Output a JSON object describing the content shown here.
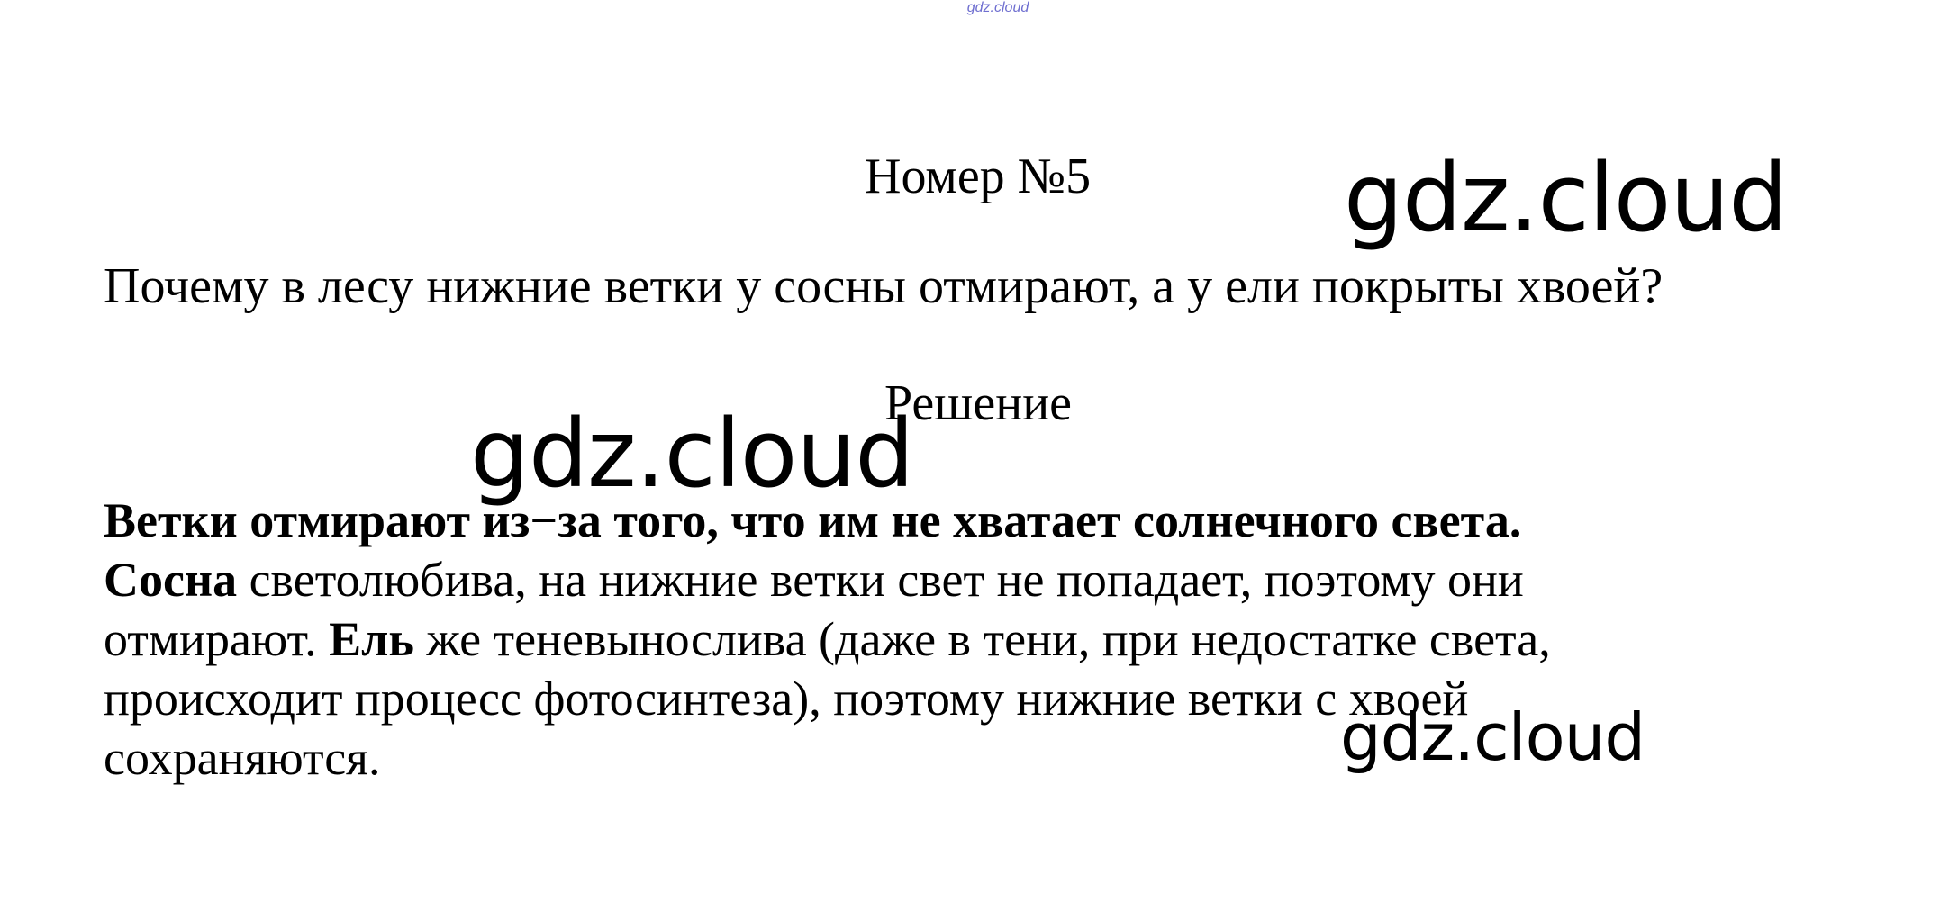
{
  "header": {
    "top_watermark": "gdz.cloud"
  },
  "task": {
    "title": "Номер №5",
    "question": "Почему в лесу нижние ветки у сосны отмирают, а у ели покрыты хвоей?",
    "solution_heading": "Решение"
  },
  "answer": {
    "line1_bold": "Ветки отмирают из−за того, что им не хватает солнечного света.",
    "line2_bold": "Сосна",
    "line2_text": " светолюбива, на нижние ветки свет не попадает, поэтому они",
    "line3_text_a": "отмирают. ",
    "line3_bold": "Ель",
    "line3_text_b": " же теневынослива (даже в тени, при недостатке света,",
    "line4_text": "происходит процесс фотосинтеза), поэтому нижние ветки с хвоей",
    "line5_text": "сохраняются."
  },
  "watermarks": {
    "wm1": "gdz.cloud",
    "wm2": "gdz.cloud",
    "wm3": "gdz.cloud"
  }
}
